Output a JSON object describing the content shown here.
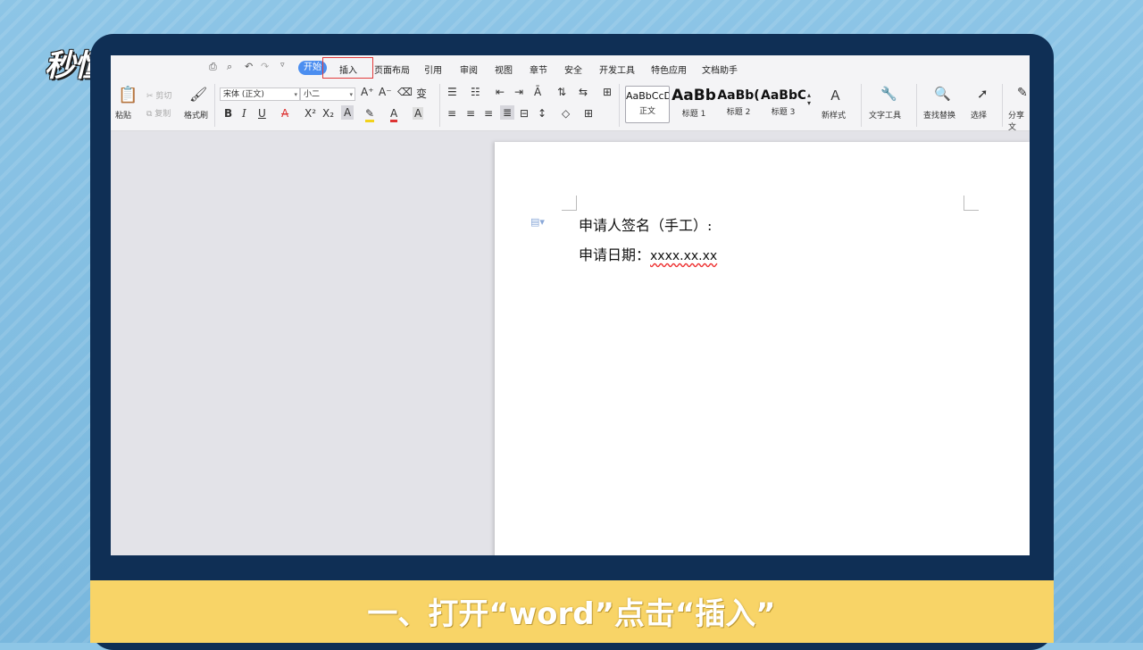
{
  "logo": "秒懂视频",
  "menu": {
    "items": [
      "开始",
      "插入",
      "页面布局",
      "引用",
      "审阅",
      "视图",
      "章节",
      "安全",
      "开发工具",
      "特色应用",
      "文档助手"
    ]
  },
  "ribbon": {
    "paste": "粘贴",
    "cut": "剪切",
    "copy": "复制",
    "format_painter": "格式刷",
    "font_name": "宋体 (正文)",
    "font_size": "小二",
    "styles": [
      {
        "sample": "AaBbCcDd",
        "name": "正文"
      },
      {
        "sample": "AaBb",
        "name": "标题 1"
      },
      {
        "sample": "AaBb(",
        "name": "标题 2"
      },
      {
        "sample": "AaBbC",
        "name": "标题 3"
      }
    ],
    "new_style": "新样式",
    "text_tools": "文字工具",
    "find_replace": "查找替换",
    "select": "选择",
    "share": "分享文"
  },
  "document": {
    "line1": "申请人签名（手工）:",
    "line2_label": "申请日期：",
    "line2_value": "xxxx.xx.xx"
  },
  "caption": "一、打开“word”点击“插入”",
  "colors": {
    "accent": "#4b8ef0",
    "highlight_box": "#e23c3c",
    "caption_bg": "#f8d467",
    "monitor": "#0f2f55"
  }
}
